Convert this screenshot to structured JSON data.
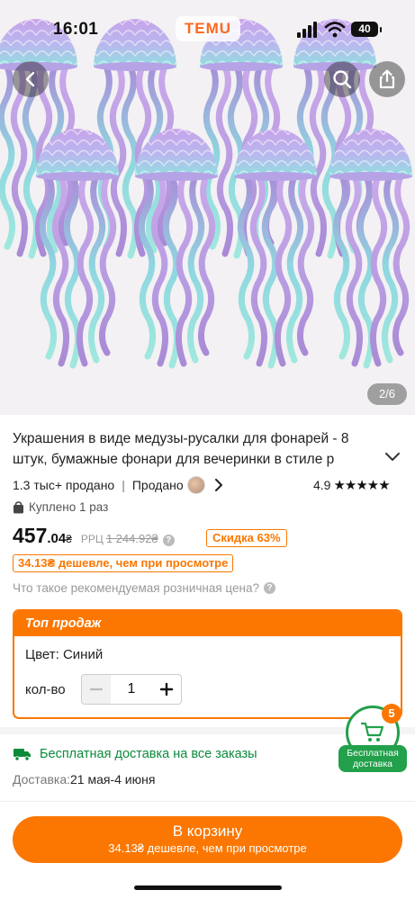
{
  "status_bar": {
    "time": "16:01",
    "logo": "TEMU",
    "battery": "40"
  },
  "gallery": {
    "indicator": "2/6"
  },
  "product": {
    "title": "Украшения в виде медузы-русалки для фонарей - 8 штук, бумажные фонари для вечеринки в стиле р",
    "sold": "1.3 тыс+ продано",
    "seller_label": "Продано",
    "rating": "4.9",
    "stars": "★★★★★",
    "bought": "Куплено 1 раз"
  },
  "price": {
    "main": "457",
    "fraction": ".04",
    "currency": "₴",
    "rrp_label": "РРЦ",
    "rrp_value": "1 244.92₴",
    "discount": "Скидка 63%",
    "cheaper": "34.13₴ дешевле, чем при просмотре",
    "rrp_question": "Что такое рекомендуемая розничная цена?"
  },
  "options": {
    "header": "Топ продаж",
    "color": "Цвет: Синий",
    "qty_label": "кол-во",
    "qty_value": "1"
  },
  "shipping": {
    "free": "Бесплатная доставка на все заказы",
    "delivery_label": "Доставка:",
    "delivery_dates": "21 мая-4 июня"
  },
  "cart": {
    "count": "5",
    "label_line1": "Бесплатная",
    "label_line2": "доставка"
  },
  "add_to_cart": {
    "title": "В корзину",
    "subtitle": "34.13₴ дешевле, чем при просмотре"
  },
  "colors": {
    "accent": "#fb7701",
    "green": "#22a04b",
    "purple": "#c8a6e6",
    "teal": "#8fe3df"
  }
}
